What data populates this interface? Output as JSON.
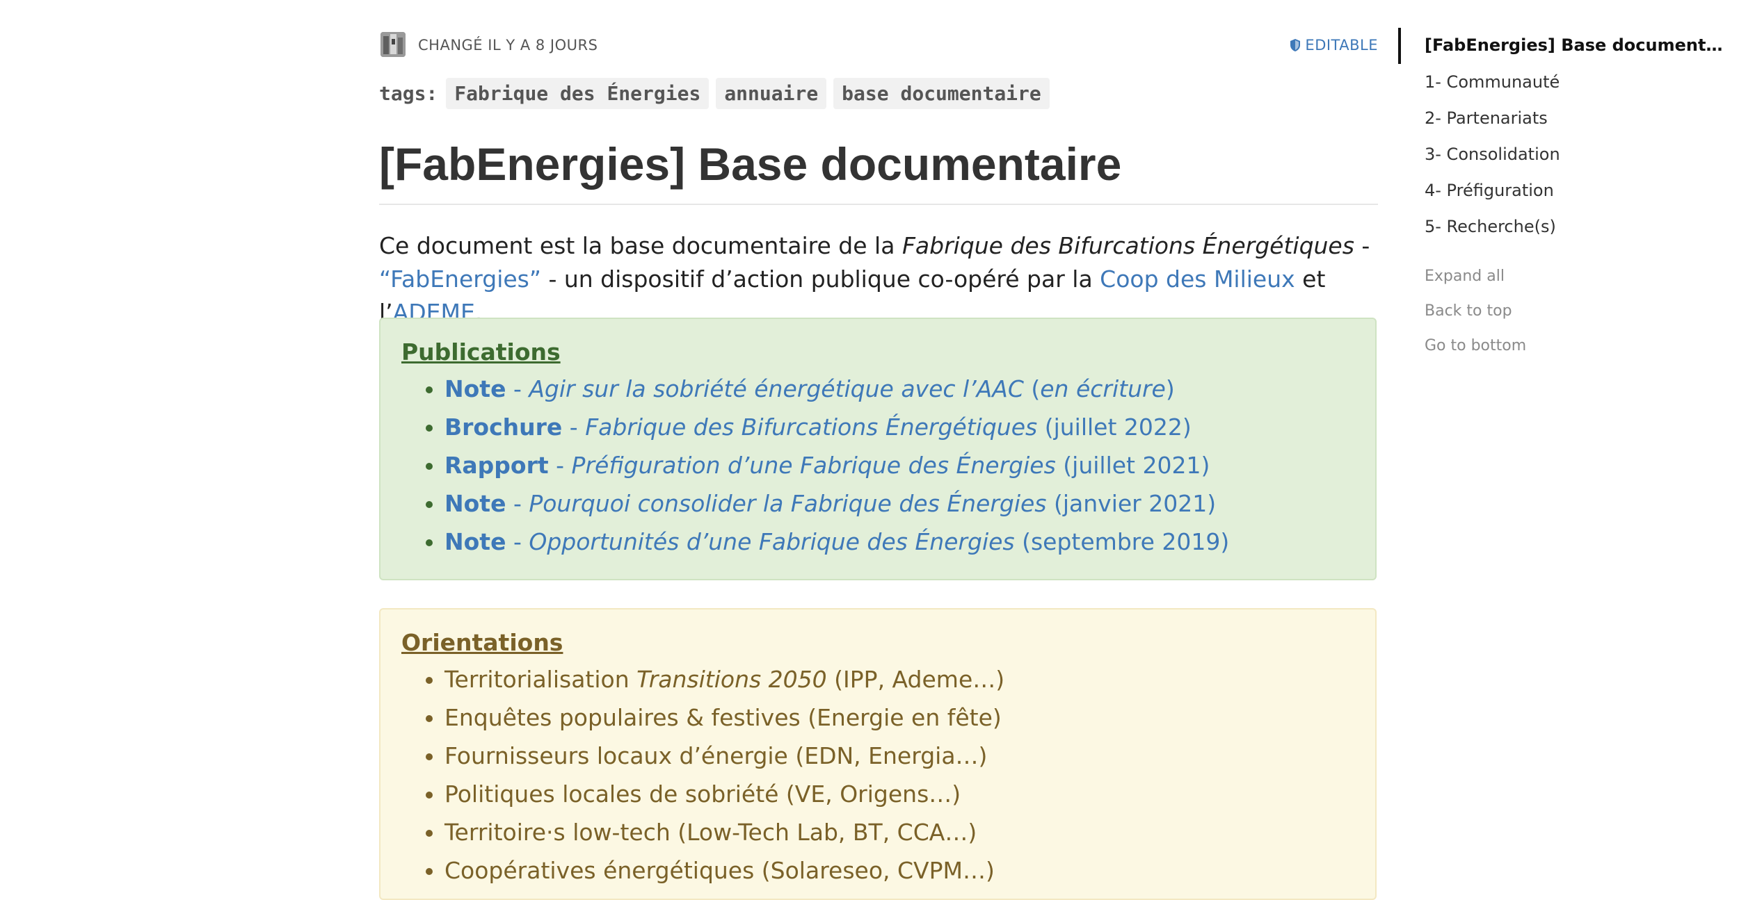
{
  "meta": {
    "changed_label": "CHANGÉ IL Y A 8 JOURS",
    "editable_label": "EDITABLE"
  },
  "tags": {
    "label": "tags:",
    "items": [
      "Fabrique des Énergies",
      "annuaire",
      "base documentaire"
    ]
  },
  "title": "[FabEnergies] Base documentaire",
  "intro": {
    "t1": "Ce document est la base documentaire de la ",
    "t2": "Fabrique des Bifurcations Énergétiques",
    "t3": " -",
    "link1": "“FabEnergies”",
    "t4": " - un dispositif d’action publique co-opéré par la ",
    "link2": "Coop des Milieux",
    "t5": " et l’",
    "link3": "ADEME",
    "t6": "."
  },
  "publications": {
    "heading": "Publications",
    "items": [
      {
        "kind": "Note",
        "sep": " - ",
        "title": "Agir sur la sobriété énergétique avec l’AAC",
        "date_open": " (",
        "date_italic": "en écriture",
        "date_close": ")"
      },
      {
        "kind": "Brochure",
        "sep": " - ",
        "title": "Fabrique des Bifurcations Énergétiques",
        "date": " (juillet 2022)"
      },
      {
        "kind": "Rapport",
        "sep": " - ",
        "title": "Préfiguration d’une Fabrique des Énergies",
        "date": " (juillet 2021)"
      },
      {
        "kind": "Note",
        "sep": " - ",
        "title": "Pourquoi consolider la Fabrique des Énergies",
        "date": " (janvier 2021)"
      },
      {
        "kind": "Note",
        "sep": " - ",
        "title": "Opportunités d’une Fabrique des Énergies",
        "date": " (septembre 2019)"
      }
    ]
  },
  "orientations": {
    "heading": "Orientations",
    "items": [
      {
        "pre": "Territorialisation ",
        "italic": "Transitions 2050",
        "post": " (IPP, Ademe…)"
      },
      {
        "text": "Enquêtes populaires & festives (Energie en fête)"
      },
      {
        "text": "Fournisseurs locaux d’énergie (EDN, Energia…)"
      },
      {
        "text": "Politiques locales de sobriété (VE, Origens…)"
      },
      {
        "text": "Territoire·s low-tech (Low-Tech Lab, BT, CCA…)"
      },
      {
        "text": "Coopératives énergétiques (Solareseo, CVPM…)"
      }
    ]
  },
  "toc": {
    "items": [
      "[FabEnergies] Base documentaire",
      "1- Communauté",
      "2- Partenariats",
      "3- Consolidation",
      "4- Préfiguration",
      "5- Recherche(s)"
    ],
    "expand_all": "Expand all",
    "back_to_top": "Back to top",
    "go_to_bottom": "Go to bottom"
  },
  "colors": {
    "link": "#3e78b8",
    "success_bg": "#e2efd9",
    "success_text": "#3d6b30",
    "warning_bg": "#fcf8e3",
    "warning_text": "#7a6128"
  }
}
